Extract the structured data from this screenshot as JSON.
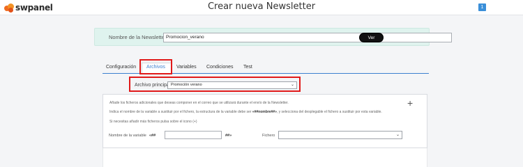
{
  "header": {
    "logo_text": "swpanel",
    "title": "Crear nueva Newsletter",
    "notification_count": "1"
  },
  "name_section": {
    "label": "Nombre de la Newsletter",
    "value": "Promocion_verano",
    "ver_button": "Ver"
  },
  "tabs": [
    {
      "label": "Configuración",
      "active": false
    },
    {
      "label": "Archivos",
      "active": true
    },
    {
      "label": "Variables",
      "active": false
    },
    {
      "label": "Condiciones",
      "active": false
    },
    {
      "label": "Test",
      "active": false
    }
  ],
  "archivo": {
    "label": "Archivo principal",
    "selected": "Promoción verano"
  },
  "panel": {
    "line1": "Añade los ficheros adicionales que deseas componer en el correo que se utilizará durante el envío de la Newsletter.",
    "line2_pre": "Indica el nombre de la variable a sustituir por el fichero, la estructura de la variable debe ser ",
    "line2_bold": "«##nombre##»",
    "line2_post": ", y selecciona del desplegable el fichero a sustituir por esta variable.",
    "line3": "Si necesitas añadir más ficheros pulsa sobre el icono (+)",
    "var_label": "Nombre de la variable",
    "var_prefix": "«##",
    "var_suffix": "##»",
    "fichero_label": "Fichero"
  },
  "colors": {
    "accent": "#3a7fd0",
    "highlight": "#e01919",
    "name_bg": "#dff3ee"
  }
}
